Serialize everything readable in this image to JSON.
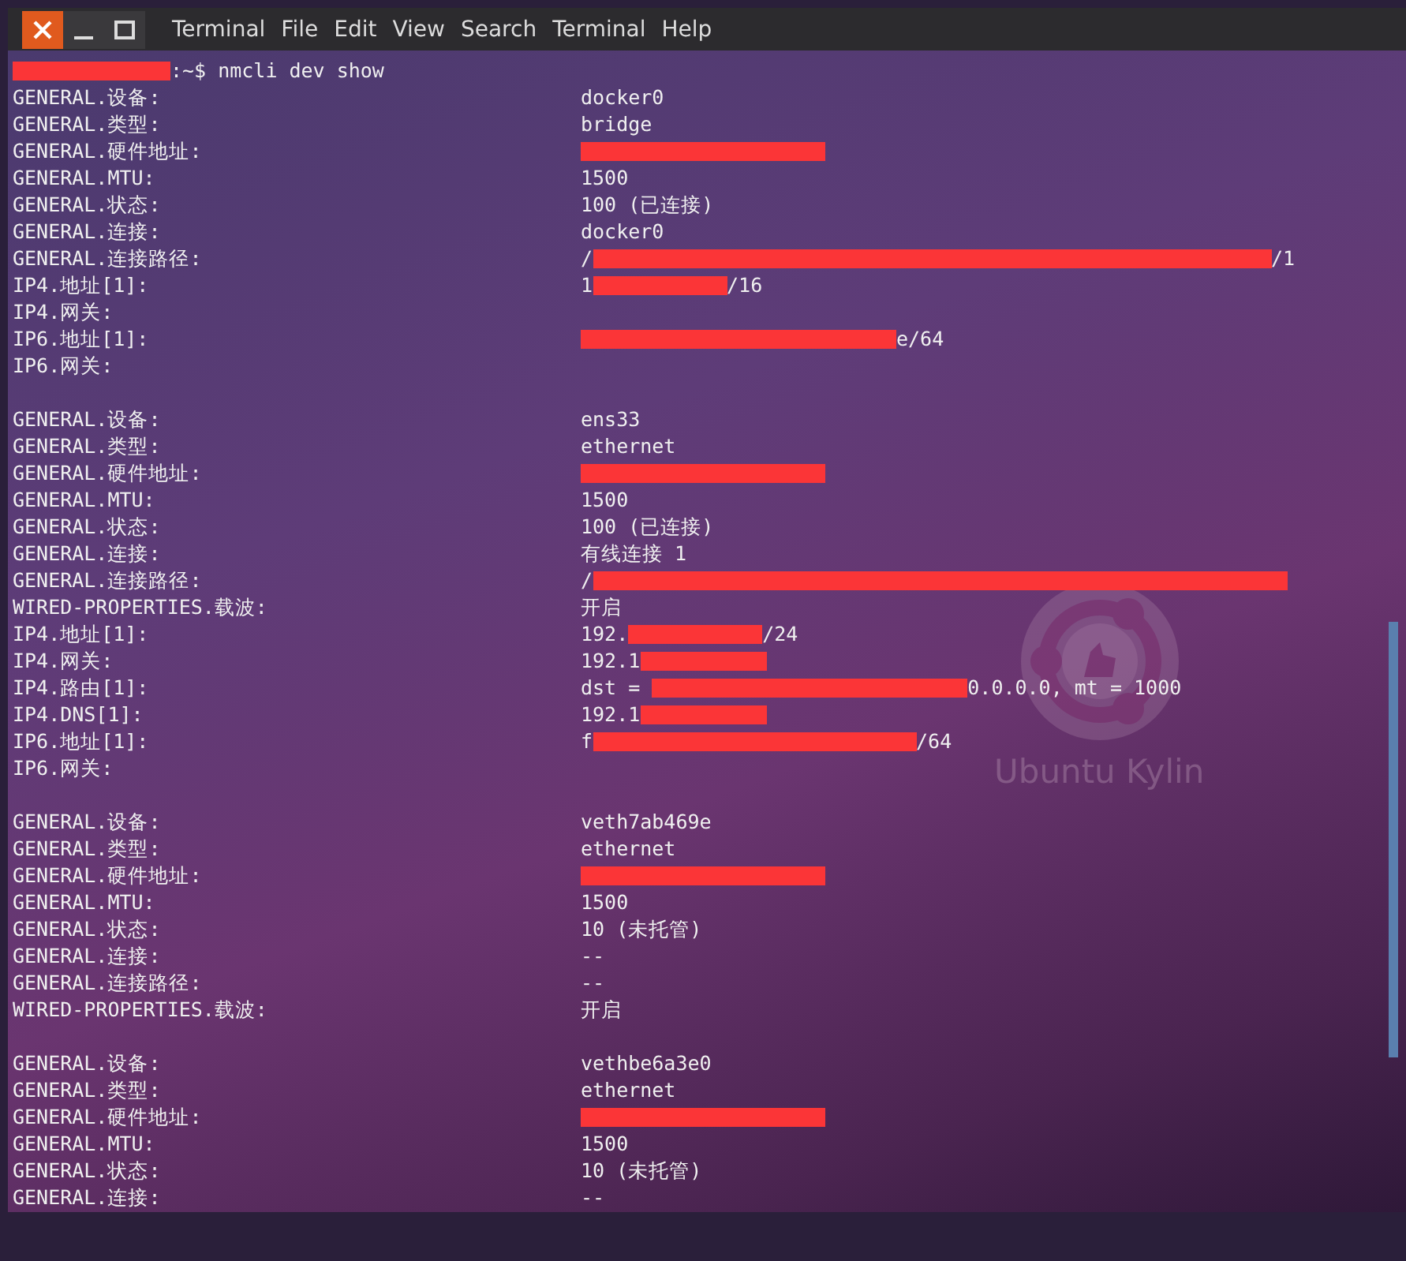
{
  "menu": [
    "Terminal",
    "File",
    "Edit",
    "View",
    "Search",
    "Terminal",
    "Help"
  ],
  "prompt": [
    {
      "kind": "redaction"
    },
    {
      "kind": "text",
      "text": ":~$ nmcli dev show"
    }
  ],
  "blocks": [
    {
      "rows": [
        {
          "key": "GENERAL.设备:",
          "value": [
            {
              "kind": "text",
              "text": "docker0"
            }
          ]
        },
        {
          "key": "GENERAL.类型:",
          "value": [
            {
              "kind": "text",
              "text": "bridge"
            }
          ]
        },
        {
          "key": "GENERAL.硬件地址:",
          "value": [
            {
              "kind": "redaction"
            }
          ]
        },
        {
          "key": "GENERAL.MTU:",
          "value": [
            {
              "kind": "text",
              "text": "1500"
            }
          ]
        },
        {
          "key": "GENERAL.状态:",
          "value": [
            {
              "kind": "text",
              "text": "100 (已连接)"
            }
          ]
        },
        {
          "key": "GENERAL.连接:",
          "value": [
            {
              "kind": "text",
              "text": "docker0"
            }
          ]
        },
        {
          "key": "GENERAL.连接路径:",
          "value": [
            {
              "kind": "text",
              "text": "/"
            },
            {
              "kind": "redaction"
            },
            {
              "kind": "text",
              "text": "/1"
            }
          ]
        },
        {
          "key": "IP4.地址[1]:",
          "value": [
            {
              "kind": "text",
              "text": "1"
            },
            {
              "kind": "redaction"
            },
            {
              "kind": "text",
              "text": "/16"
            }
          ]
        },
        {
          "key": "IP4.网关:"
        },
        {
          "key": "IP6.地址[1]:",
          "value": [
            {
              "kind": "redaction"
            },
            {
              "kind": "text",
              "text": "e/64"
            }
          ]
        },
        {
          "key": "IP6.网关:"
        }
      ]
    },
    {
      "rows": [
        {
          "key": "GENERAL.设备:",
          "value": [
            {
              "kind": "text",
              "text": "ens33"
            }
          ]
        },
        {
          "key": "GENERAL.类型:",
          "value": [
            {
              "kind": "text",
              "text": "ethernet"
            }
          ]
        },
        {
          "key": "GENERAL.硬件地址:",
          "value": [
            {
              "kind": "redaction"
            }
          ]
        },
        {
          "key": "GENERAL.MTU:",
          "value": [
            {
              "kind": "text",
              "text": "1500"
            }
          ]
        },
        {
          "key": "GENERAL.状态:",
          "value": [
            {
              "kind": "text",
              "text": "100 (已连接)"
            }
          ]
        },
        {
          "key": "GENERAL.连接:",
          "value": [
            {
              "kind": "text",
              "text": "有线连接 1"
            }
          ]
        },
        {
          "key": "GENERAL.连接路径:",
          "value": [
            {
              "kind": "text",
              "text": "/"
            },
            {
              "kind": "redaction"
            }
          ]
        },
        {
          "key": "WIRED-PROPERTIES.载波:",
          "value": [
            {
              "kind": "text",
              "text": "开启"
            }
          ]
        },
        {
          "key": "IP4.地址[1]:",
          "value": [
            {
              "kind": "text",
              "text": "192."
            },
            {
              "kind": "redaction"
            },
            {
              "kind": "text",
              "text": "/24"
            }
          ]
        },
        {
          "key": "IP4.网关:",
          "value": [
            {
              "kind": "text",
              "text": "192.1"
            },
            {
              "kind": "redaction"
            }
          ]
        },
        {
          "key": "IP4.路由[1]:",
          "value": [
            {
              "kind": "text",
              "text": "dst = "
            },
            {
              "kind": "redaction"
            },
            {
              "kind": "text",
              "text": "0.0.0.0, mt = 1000"
            }
          ]
        },
        {
          "key": "IP4.DNS[1]:",
          "value": [
            {
              "kind": "text",
              "text": "192.1"
            },
            {
              "kind": "redaction"
            }
          ]
        },
        {
          "key": "IP6.地址[1]:",
          "value": [
            {
              "kind": "text",
              "text": "f"
            },
            {
              "kind": "redaction"
            },
            {
              "kind": "text",
              "text": "/64"
            }
          ]
        },
        {
          "key": "IP6.网关:"
        }
      ]
    },
    {
      "rows": [
        {
          "key": "GENERAL.设备:",
          "value": [
            {
              "kind": "text",
              "text": "veth7ab469e"
            }
          ]
        },
        {
          "key": "GENERAL.类型:",
          "value": [
            {
              "kind": "text",
              "text": "ethernet"
            }
          ]
        },
        {
          "key": "GENERAL.硬件地址:",
          "value": [
            {
              "kind": "redaction"
            }
          ]
        },
        {
          "key": "GENERAL.MTU:",
          "value": [
            {
              "kind": "text",
              "text": "1500"
            }
          ]
        },
        {
          "key": "GENERAL.状态:",
          "value": [
            {
              "kind": "text",
              "text": "10 (未托管)"
            }
          ]
        },
        {
          "key": "GENERAL.连接:",
          "value": [
            {
              "kind": "text",
              "text": "--"
            }
          ]
        },
        {
          "key": "GENERAL.连接路径:",
          "value": [
            {
              "kind": "text",
              "text": "--"
            }
          ]
        },
        {
          "key": "WIRED-PROPERTIES.载波:",
          "value": [
            {
              "kind": "text",
              "text": "开启"
            }
          ]
        }
      ]
    },
    {
      "rows": [
        {
          "key": "GENERAL.设备:",
          "value": [
            {
              "kind": "text",
              "text": "vethbe6a3e0"
            }
          ]
        },
        {
          "key": "GENERAL.类型:",
          "value": [
            {
              "kind": "text",
              "text": "ethernet"
            }
          ]
        },
        {
          "key": "GENERAL.硬件地址:",
          "value": [
            {
              "kind": "redaction"
            }
          ]
        },
        {
          "key": "GENERAL.MTU:",
          "value": [
            {
              "kind": "text",
              "text": "1500"
            }
          ]
        },
        {
          "key": "GENERAL.状态:",
          "value": [
            {
              "kind": "text",
              "text": "10 (未托管)"
            }
          ]
        },
        {
          "key": "GENERAL.连接:",
          "value": [
            {
              "kind": "text",
              "text": "--"
            }
          ]
        }
      ]
    }
  ],
  "wallpaper": {
    "brand": "Ubuntu Kylin"
  }
}
